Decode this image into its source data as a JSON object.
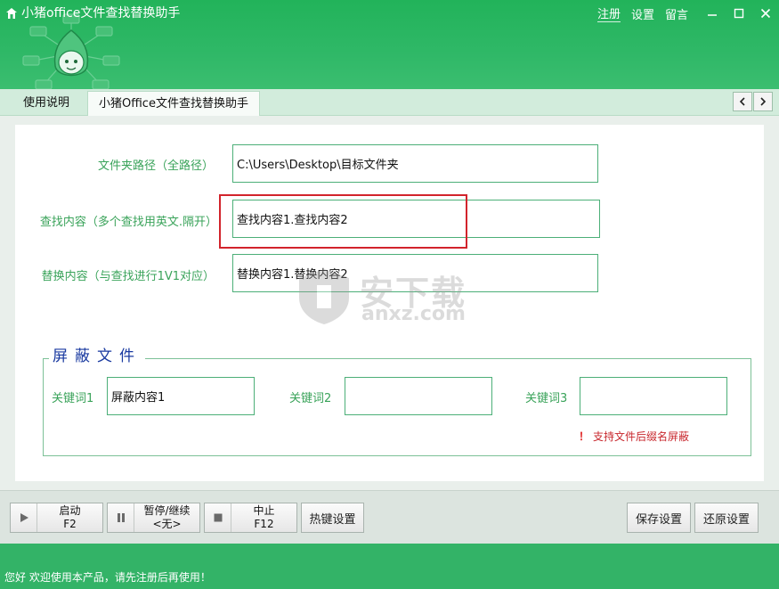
{
  "window": {
    "title": "小猪office文件查找替换助手",
    "links": [
      "注册",
      "设置",
      "留言"
    ]
  },
  "tabs": [
    "使用说明",
    "小猪Office文件查找替换助手"
  ],
  "form": {
    "folder_label": "文件夹路径（全路径）",
    "folder_value": "C:\\Users\\Desktop\\目标文件夹",
    "find_label": "查找内容（多个查找用英文.隔开）",
    "find_value": "查找内容1.查找内容2",
    "replace_label": "替换内容（与查找进行1V1对应）",
    "replace_value": "替换内容1.替换内容2"
  },
  "shield": {
    "title": "屏蔽文件",
    "keyword1_label": "关键词1",
    "keyword1_value": "屏蔽内容1",
    "keyword2_label": "关键词2",
    "keyword2_value": "",
    "keyword3_label": "关键词3",
    "keyword3_value": "",
    "warning_mark": "！",
    "warning_text": "支持文件后缀名屏蔽"
  },
  "watermark": {
    "text": "安下载",
    "url": "anxz.com"
  },
  "toolbar": {
    "start_label": "启动",
    "start_key": "F2",
    "pause_label": "暂停/继续",
    "pause_key": "<无>",
    "stop_label": "中止",
    "stop_key": "F12",
    "hotkey_label": "热键设置",
    "save_label": "保存设置",
    "restore_label": "还原设置"
  },
  "status": {
    "text": "您好 欢迎使用本产品，请先注册后再使用！"
  },
  "colors": {
    "brand_green": "#2bb261",
    "field_border": "#4caf78",
    "label_green": "#3aa35a",
    "highlight_red": "#d2242c",
    "group_title_blue": "#1a3aa0"
  }
}
